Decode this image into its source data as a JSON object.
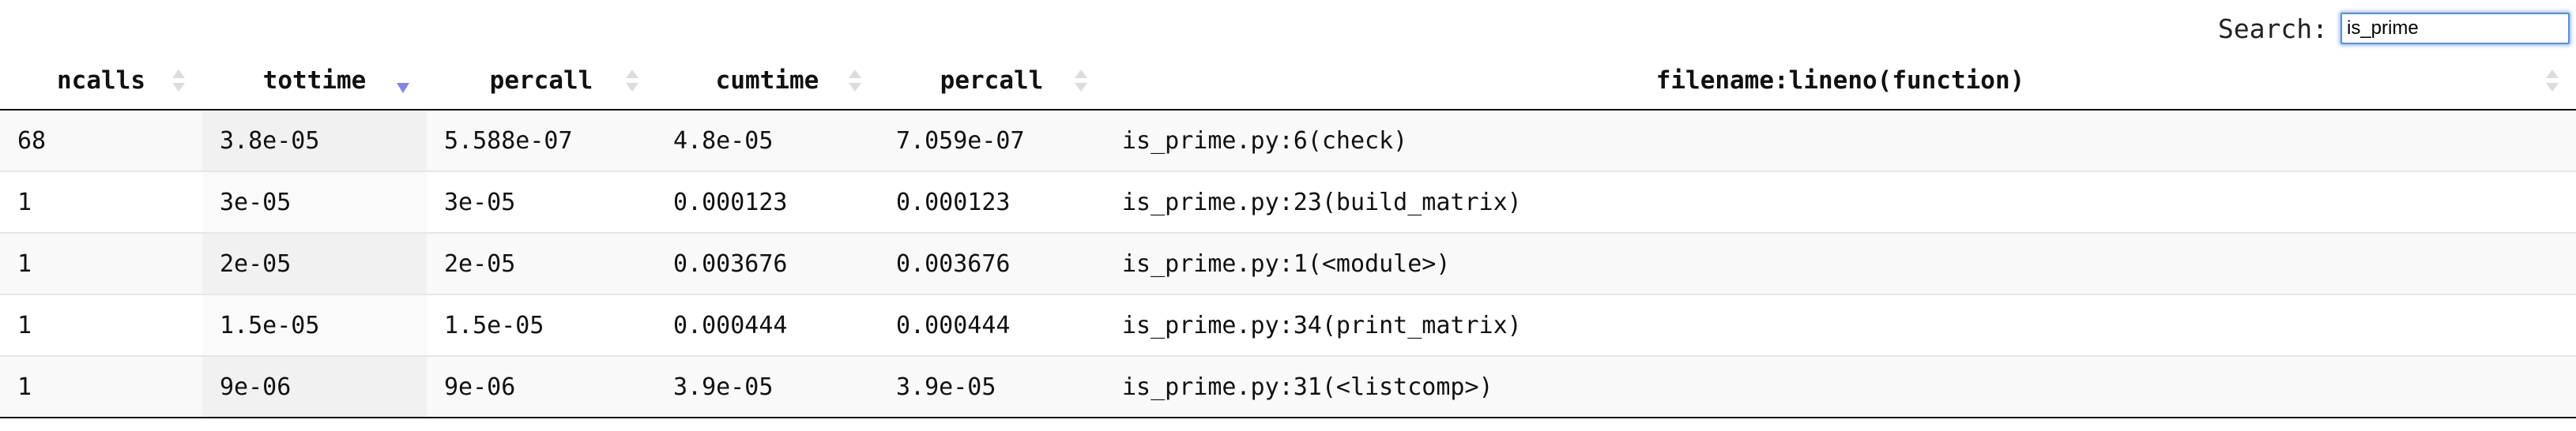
{
  "search": {
    "label": "Search:",
    "value": "is_prime"
  },
  "table": {
    "columns": [
      "ncalls",
      "tottime",
      "percall",
      "cumtime",
      "percall",
      "filename:lineno(function)"
    ],
    "sorted_column": "tottime",
    "sort_direction": "descending",
    "sort_indicator_color": "#7f86e6",
    "rows": [
      [
        "68",
        "3.8e-05",
        "5.588e-07",
        "4.8e-05",
        "7.059e-07",
        "is_prime.py:6(check)"
      ],
      [
        "1",
        "3e-05",
        "3e-05",
        "0.000123",
        "0.000123",
        "is_prime.py:23(build_matrix)"
      ],
      [
        "1",
        "2e-05",
        "2e-05",
        "0.003676",
        "0.003676",
        "is_prime.py:1(<module>)"
      ],
      [
        "1",
        "1.5e-05",
        "1.5e-05",
        "0.000444",
        "0.000444",
        "is_prime.py:34(print_matrix)"
      ],
      [
        "1",
        "9e-06",
        "9e-06",
        "3.9e-05",
        "3.9e-05",
        "is_prime.py:31(<listcomp>)"
      ]
    ]
  }
}
